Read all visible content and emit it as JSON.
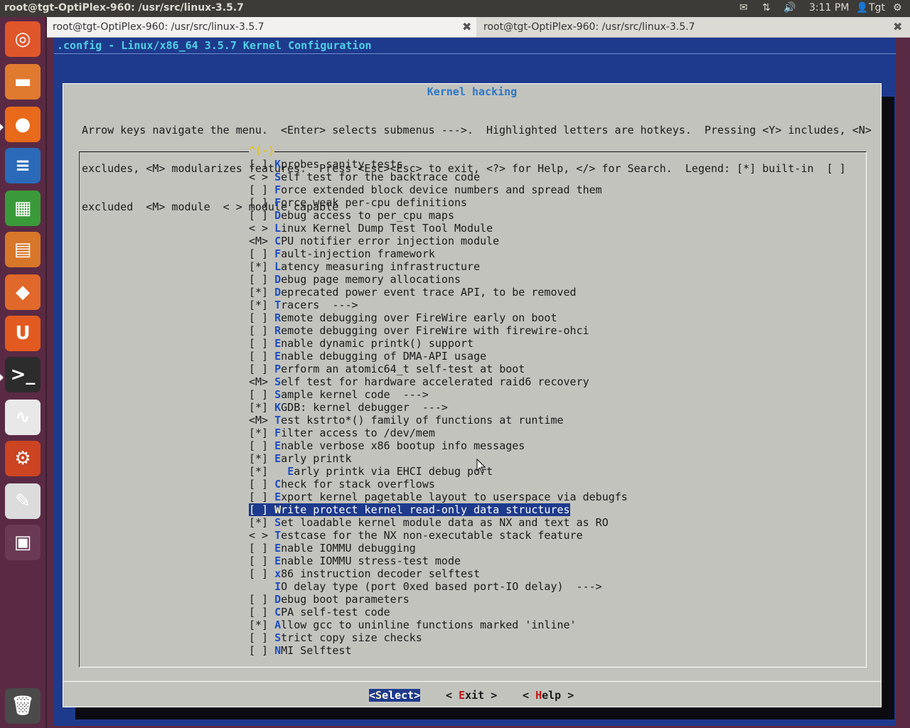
{
  "panel": {
    "title": "root@tgt-OptiPlex-960: /usr/src/linux-3.5.7",
    "time": "3:11 PM",
    "user": "Tgt"
  },
  "launcher": {
    "items": [
      {
        "name": "ubuntu-dash-icon",
        "glyph": "◎",
        "color": "#e0562b"
      },
      {
        "name": "files-icon",
        "glyph": "▬",
        "color": "#e07a2f"
      },
      {
        "name": "firefox-icon",
        "glyph": "●",
        "color": "#e86a1a"
      },
      {
        "name": "writer-icon",
        "glyph": "≡",
        "color": "#2a6ab8"
      },
      {
        "name": "calc-icon",
        "glyph": "▦",
        "color": "#3a9a3a"
      },
      {
        "name": "impress-icon",
        "glyph": "▤",
        "color": "#d8762a"
      },
      {
        "name": "software-center-icon",
        "glyph": "◆",
        "color": "#e0682a"
      },
      {
        "name": "ubuntu-one-icon",
        "glyph": "U",
        "color": "#e25a20"
      },
      {
        "name": "terminal-icon",
        "glyph": ">_",
        "color": "#2c2c2c"
      },
      {
        "name": "pdf-viewer-icon",
        "glyph": "∿",
        "color": "#e8e8e8"
      },
      {
        "name": "system-settings-icon",
        "glyph": "⚙",
        "color": "#cc4422"
      },
      {
        "name": "text-editor-icon",
        "glyph": "✎",
        "color": "#dcdcdc"
      },
      {
        "name": "workspace-switcher-icon",
        "glyph": "▣",
        "color": "#6a3a55"
      },
      {
        "name": "trash-icon",
        "glyph": "🗑",
        "color": "#4a4a4a"
      }
    ]
  },
  "tabs": [
    {
      "label": "root@tgt-OptiPlex-960: /usr/src/linux-3.5.7",
      "close": "✖"
    },
    {
      "label": "root@tgt-OptiPlex-960: /usr/src/linux-3.5.7",
      "close": "✖"
    }
  ],
  "terminal": {
    "header": ".config - Linux/x86_64 3.5.7 Kernel Configuration",
    "dialog_title": "Kernel hacking",
    "help_lines": [
      "Arrow keys navigate the menu.  <Enter> selects submenus --->.  Highlighted letters are hotkeys.  Pressing <Y> includes, <N>",
      "excludes, <M> modularizes features.  Press <Esc><Esc> to exit, <?> for Help, </> for Search.  Legend: [*] built-in  [ ]",
      "excluded  <M> module  < > module capable"
    ],
    "scroll_indicator": "^(-)",
    "items": [
      {
        "box": "[ ] ",
        "key": "K",
        "rest": "probes sanity tests"
      },
      {
        "box": "< > ",
        "key": "S",
        "rest": "elf test for the backtrace code"
      },
      {
        "box": "[ ] ",
        "key": "F",
        "rest": "orce extended block device numbers and spread them"
      },
      {
        "box": "[ ] ",
        "key": "F",
        "rest": "orce weak per-cpu definitions"
      },
      {
        "box": "[ ] ",
        "key": "D",
        "rest": "ebug access to per_cpu maps"
      },
      {
        "box": "< > ",
        "key": "L",
        "rest": "inux Kernel Dump Test Tool Module"
      },
      {
        "box": "<M> ",
        "key": "C",
        "rest": "PU notifier error injection module"
      },
      {
        "box": "[ ] ",
        "key": "F",
        "rest": "ault-injection framework"
      },
      {
        "box": "[*] ",
        "key": "L",
        "rest": "atency measuring infrastructure"
      },
      {
        "box": "[ ] ",
        "key": "D",
        "rest": "ebug page memory allocations"
      },
      {
        "box": "[*] ",
        "key": "D",
        "rest": "eprecated power event trace API, to be removed"
      },
      {
        "box": "[*] ",
        "key": "T",
        "rest": "racers  --->"
      },
      {
        "box": "[ ] ",
        "key": "R",
        "rest": "emote debugging over FireWire early on boot"
      },
      {
        "box": "[ ] ",
        "key": "R",
        "rest": "emote debugging over FireWire with firewire-ohci"
      },
      {
        "box": "[ ] ",
        "key": "E",
        "rest": "nable dynamic printk() support"
      },
      {
        "box": "[ ] ",
        "key": "E",
        "rest": "nable debugging of DMA-API usage"
      },
      {
        "box": "[ ] ",
        "key": "P",
        "rest": "erform an atomic64_t self-test at boot"
      },
      {
        "box": "<M> ",
        "key": "S",
        "rest": "elf test for hardware accelerated raid6 recovery"
      },
      {
        "box": "[ ] ",
        "key": "S",
        "rest": "ample kernel code  --->"
      },
      {
        "box": "[*] ",
        "key": "K",
        "rest": "GDB: kernel debugger  --->"
      },
      {
        "box": "<M> ",
        "key": "T",
        "rest": "est kstrto*() family of functions at runtime"
      },
      {
        "box": "[*] ",
        "key": "F",
        "rest": "ilter access to /dev/mem"
      },
      {
        "box": "[ ] ",
        "key": "E",
        "rest": "nable verbose x86 bootup info messages"
      },
      {
        "box": "[*] ",
        "key": "E",
        "rest": "arly printk"
      },
      {
        "box": "[*]   ",
        "key": "E",
        "rest": "arly printk via EHCI debug port"
      },
      {
        "box": "[ ] ",
        "key": "C",
        "rest": "heck for stack overflows"
      },
      {
        "box": "[ ] ",
        "key": "E",
        "rest": "xport kernel pagetable layout to userspace via debugfs"
      },
      {
        "box": "[ ] ",
        "key": "W",
        "rest": "rite protect kernel read-only data structures",
        "selected": true
      },
      {
        "box": "[*] ",
        "key": "S",
        "rest": "et loadable kernel module data as NX and text as RO"
      },
      {
        "box": "< > ",
        "key": "T",
        "rest": "estcase for the NX non-executable stack feature"
      },
      {
        "box": "[ ] ",
        "key": "E",
        "rest": "nable IOMMU debugging"
      },
      {
        "box": "[ ] ",
        "key": "E",
        "rest": "nable IOMMU stress-test mode"
      },
      {
        "box": "[ ] ",
        "key": "x",
        "rest": "86 instruction decoder selftest"
      },
      {
        "box": "    ",
        "key": "I",
        "rest": "O delay type (port 0xed based port-IO delay)  --->"
      },
      {
        "box": "[ ] ",
        "key": "D",
        "rest": "ebug boot parameters"
      },
      {
        "box": "[ ] ",
        "key": "C",
        "rest": "PA self-test code"
      },
      {
        "box": "[*] ",
        "key": "A",
        "rest": "llow gcc to uninline functions marked 'inline'"
      },
      {
        "box": "[ ] ",
        "key": "S",
        "rest": "trict copy size checks"
      },
      {
        "box": "[ ] ",
        "key": "N",
        "rest": "MI Selftest"
      }
    ],
    "buttons": [
      {
        "pre": "<",
        "hk": "S",
        "post": "elect>",
        "active": true
      },
      {
        "pre": "< ",
        "hk": "E",
        "post": "xit >",
        "active": false
      },
      {
        "pre": "< ",
        "hk": "H",
        "post": "elp >",
        "active": false
      }
    ]
  }
}
